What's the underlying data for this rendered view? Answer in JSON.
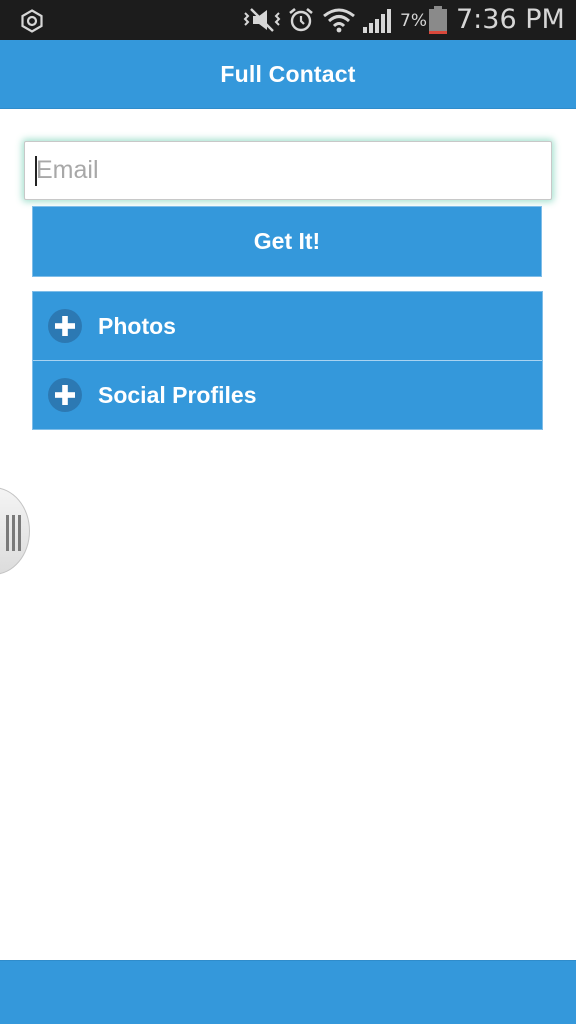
{
  "status_bar": {
    "battery_percent": "7%",
    "time": "7:36 PM",
    "icons": [
      "settings-icon",
      "mute-icon",
      "alarm-icon",
      "wifi-icon",
      "signal-icon",
      "battery-icon"
    ]
  },
  "header": {
    "title": "Full Contact"
  },
  "form": {
    "email_placeholder": "Email",
    "email_value": "",
    "submit_label": "Get It!"
  },
  "sections": [
    {
      "label": "Photos",
      "icon": "plus-icon",
      "expanded": false
    },
    {
      "label": "Social Profiles",
      "icon": "plus-icon",
      "expanded": false
    }
  ],
  "colors": {
    "accent": "#3498db",
    "status_bar": "#1c1c1c",
    "focus_glow": "#3cbe96"
  }
}
